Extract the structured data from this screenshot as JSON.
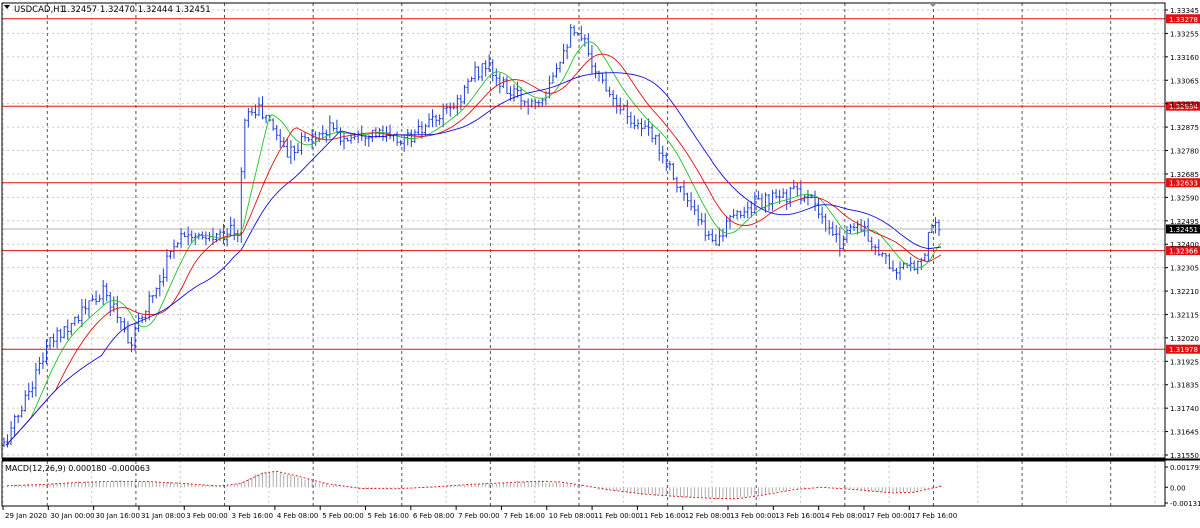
{
  "header": {
    "symbol": "USDCAD,H1",
    "ohlc": "1.32457 1.32470 1.32444 1.32451"
  },
  "macd_header": "MACD(12,26,9) 0.000180 -0.000063",
  "colors": {
    "bar": "#1f3fd8",
    "ma_fast": "#22c322",
    "ma_mid": "#e01010",
    "ma_slow": "#1010e0",
    "level": "#e01010",
    "macd_hist": "#9a9a9a",
    "macd_signal": "#e01010",
    "price_badge": "#000000"
  },
  "chart_data": [
    {
      "type": "ohlc",
      "symbol": "USDCAD,H1",
      "ylim": [
        1.3155,
        1.3334
      ],
      "y_ticks": [
        "1.33345",
        "1.33255",
        "1.33160",
        "1.33065",
        "1.32970",
        "1.32875",
        "1.32780",
        "1.32685",
        "1.32590",
        "1.32495",
        "1.32400",
        "1.32305",
        "1.32210",
        "1.32115",
        "1.32020",
        "1.31925",
        "1.31835",
        "1.31740",
        "1.31645",
        "1.31550"
      ],
      "x_ticks": [
        "29 Jan 2020",
        "30 Jan 00:00",
        "30 Jan 16:00",
        "31 Jan 08:00",
        "3 Feb 00:00",
        "3 Feb 16:00",
        "4 Feb 08:00",
        "5 Feb 00:00",
        "5 Feb 16:00",
        "6 Feb 08:00",
        "7 Feb 00:00",
        "7 Feb 16:00",
        "10 Feb 08:00",
        "11 Feb 00:00",
        "11 Feb 16:00",
        "12 Feb 08:00",
        "13 Feb 00:00",
        "13 Feb 16:00",
        "14 Feb 08:00",
        "17 Feb 00:00",
        "17 Feb 16:00"
      ],
      "levels": [
        {
          "value": 1.33278,
          "label": "1.33278"
        },
        {
          "value": 1.32934,
          "label": "1.32934"
        },
        {
          "value": 1.32633,
          "label": "1.32633"
        },
        {
          "value": 1.32366,
          "label": "1.32366"
        },
        {
          "value": 1.31978,
          "label": "1.31978"
        }
      ],
      "current_price": {
        "value": 1.32451,
        "label": "1.32451"
      },
      "close_path": [
        [
          0,
          1.316
        ],
        [
          4,
          1.3172
        ],
        [
          8,
          1.3185
        ],
        [
          12,
          1.3198
        ],
        [
          16,
          1.3205
        ],
        [
          20,
          1.321
        ],
        [
          24,
          1.3215
        ],
        [
          28,
          1.322
        ],
        [
          32,
          1.3212
        ],
        [
          36,
          1.32
        ],
        [
          40,
          1.3215
        ],
        [
          44,
          1.3225
        ],
        [
          48,
          1.324
        ],
        [
          52,
          1.3245
        ],
        [
          56,
          1.324
        ],
        [
          60,
          1.3242
        ],
        [
          64,
          1.3245
        ],
        [
          66,
          1.3242
        ],
        [
          68,
          1.329
        ],
        [
          72,
          1.3292
        ],
        [
          76,
          1.3285
        ],
        [
          80,
          1.3275
        ],
        [
          84,
          1.328
        ],
        [
          88,
          1.3282
        ],
        [
          92,
          1.3285
        ],
        [
          96,
          1.328
        ],
        [
          100,
          1.3284
        ],
        [
          104,
          1.3283
        ],
        [
          108,
          1.3281
        ],
        [
          112,
          1.328
        ],
        [
          116,
          1.3282
        ],
        [
          120,
          1.3286
        ],
        [
          124,
          1.329
        ],
        [
          128,
          1.3295
        ],
        [
          132,
          1.3305
        ],
        [
          136,
          1.331
        ],
        [
          140,
          1.3302
        ],
        [
          144,
          1.3298
        ],
        [
          148,
          1.3295
        ],
        [
          152,
          1.3298
        ],
        [
          156,
          1.331
        ],
        [
          160,
          1.3322
        ],
        [
          164,
          1.3318
        ],
        [
          168,
          1.3305
        ],
        [
          172,
          1.3298
        ],
        [
          176,
          1.329
        ],
        [
          180,
          1.3285
        ],
        [
          184,
          1.328
        ],
        [
          188,
          1.327
        ],
        [
          192,
          1.3258
        ],
        [
          196,
          1.3248
        ],
        [
          200,
          1.324
        ],
        [
          204,
          1.3246
        ],
        [
          208,
          1.3252
        ],
        [
          212,
          1.3255
        ],
        [
          216,
          1.3256
        ],
        [
          220,
          1.3258
        ],
        [
          224,
          1.326
        ],
        [
          228,
          1.3256
        ],
        [
          232,
          1.3245
        ],
        [
          236,
          1.324
        ],
        [
          240,
          1.3248
        ],
        [
          244,
          1.3242
        ],
        [
          248,
          1.3235
        ],
        [
          252,
          1.3228
        ],
        [
          256,
          1.323
        ],
        [
          260,
          1.3236
        ],
        [
          262,
          1.3248
        ],
        [
          264,
          1.3245
        ]
      ]
    },
    {
      "type": "line",
      "name": "MACD(12,26,9)",
      "ylim": [
        -0.0015,
        0.0021
      ],
      "y_ticks": [
        "0.001795",
        "0.00",
        "-0.001311"
      ],
      "signal_path": [
        [
          0,
          0.00012
        ],
        [
          10,
          0.00022
        ],
        [
          20,
          0.00038
        ],
        [
          30,
          0.00048
        ],
        [
          40,
          0.00045
        ],
        [
          50,
          0.0003
        ],
        [
          60,
          0.0001
        ],
        [
          66,
          0.0003
        ],
        [
          72,
          0.0011
        ],
        [
          76,
          0.00128
        ],
        [
          82,
          0.0009
        ],
        [
          90,
          0.0003
        ],
        [
          100,
          -0.0001
        ],
        [
          110,
          -0.00012
        ],
        [
          120,
          2e-05
        ],
        [
          130,
          0.00022
        ],
        [
          140,
          0.00035
        ],
        [
          150,
          0.00048
        ],
        [
          156,
          0.00042
        ],
        [
          162,
          0.00018
        ],
        [
          170,
          -0.0002
        ],
        [
          180,
          -0.00055
        ],
        [
          190,
          -0.00075
        ],
        [
          200,
          -0.0009
        ],
        [
          206,
          -0.00092
        ],
        [
          214,
          -0.0006
        ],
        [
          222,
          -0.0002
        ],
        [
          230,
          0.0
        ],
        [
          240,
          -0.0002
        ],
        [
          250,
          -0.00045
        ],
        [
          256,
          -0.0004
        ],
        [
          264,
          0.0001
        ]
      ]
    }
  ]
}
